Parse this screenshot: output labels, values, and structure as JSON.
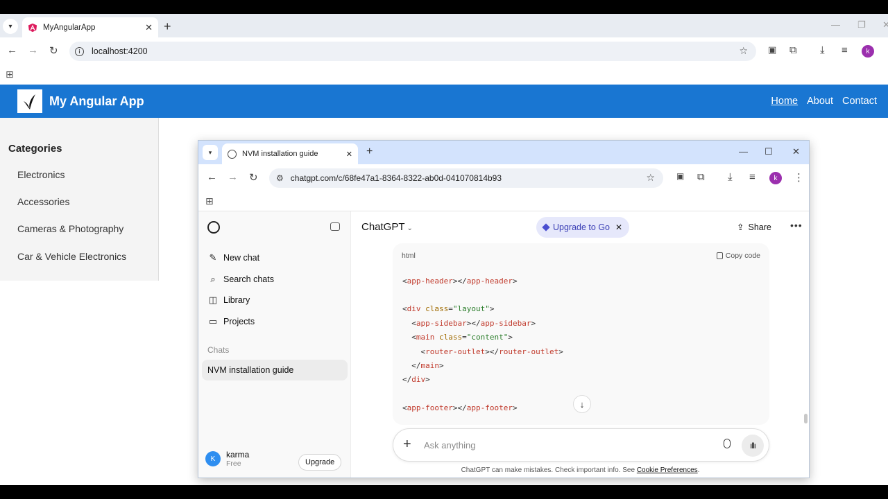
{
  "outer_browser": {
    "tab_title": "MyAngularApp",
    "url": "localhost:4200",
    "profile_initial": "k"
  },
  "app": {
    "title": "My Angular App",
    "nav": [
      "Home",
      "About",
      "Contact"
    ],
    "active_nav": "Home",
    "categories_title": "Categories",
    "categories": [
      "Electronics",
      "Accessories",
      "Cameras & Photography",
      "Car & Vehicle Electronics"
    ],
    "header_color": "#1976d2"
  },
  "inner_browser": {
    "tab_title": "NVM installation guide",
    "url": "chatgpt.com/c/68fe47a1-8364-8322-ab0d-041070814b93",
    "profile_initial": "k"
  },
  "chatgpt": {
    "sidebar": {
      "items": [
        {
          "label": "New chat",
          "icon": "pencil-icon"
        },
        {
          "label": "Search chats",
          "icon": "search-icon"
        },
        {
          "label": "Library",
          "icon": "library-icon"
        },
        {
          "label": "Projects",
          "icon": "folder-icon"
        }
      ],
      "chats_label": "Chats",
      "active_chat": "NVM installation guide",
      "user_name": "karma",
      "user_plan": "Free",
      "user_initial": "K",
      "upgrade_label": "Upgrade"
    },
    "header": {
      "model": "ChatGPT",
      "upgrade_pill": "Upgrade to Go",
      "share": "Share"
    },
    "code_block": {
      "language": "html",
      "copy_label": "Copy code"
    },
    "composer_placeholder": "Ask anything",
    "disclaimer": "ChatGPT can make mistakes. Check important info. See",
    "disclaimer_link": "Cookie Preferences"
  }
}
